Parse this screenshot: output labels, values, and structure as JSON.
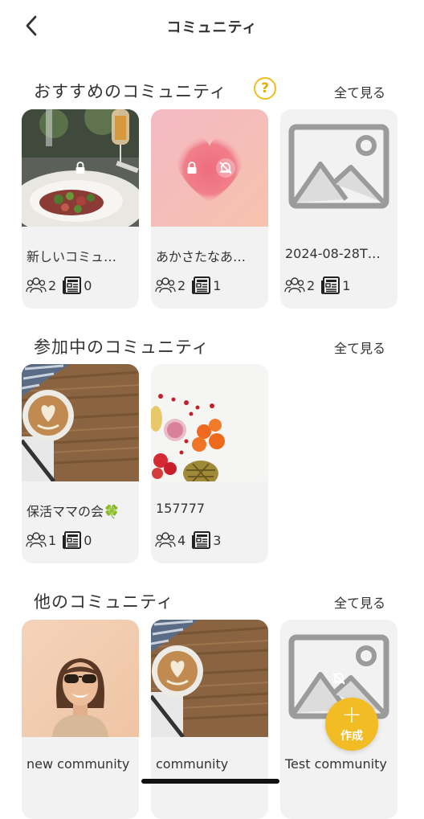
{
  "header": {
    "title": "コミュニティ"
  },
  "sections": {
    "recommended": {
      "title": "おすすめのコミュニティ",
      "see_all": "全て見る",
      "cards": [
        {
          "name": "新しいコミュ…",
          "members": "2",
          "posts": "0"
        },
        {
          "name": "あかさたなあ…",
          "members": "2",
          "posts": "1"
        },
        {
          "name": "2024-08-28T…",
          "members": "2",
          "posts": "1"
        }
      ]
    },
    "joined": {
      "title": "参加中のコミュニティ",
      "see_all": "全て見る",
      "cards": [
        {
          "name": "保活ママの会🍀",
          "members": "1",
          "posts": "0"
        },
        {
          "name": "157777",
          "members": "4",
          "posts": "3"
        }
      ]
    },
    "other": {
      "title": "他のコミュニティ",
      "see_all": "全て見る",
      "cards": [
        {
          "name": "new community"
        },
        {
          "name": "community"
        },
        {
          "name": "Test community"
        }
      ]
    }
  },
  "fab": {
    "plus": "+",
    "label": "作成"
  },
  "colors": {
    "accent": "#f2bc24",
    "card_bg": "#f2f2f2",
    "text": "#333333"
  },
  "icons": [
    "chevron-left-icon",
    "help-icon",
    "lock-icon",
    "bell-off-icon",
    "members-icon",
    "posts-icon",
    "image-placeholder-icon"
  ]
}
